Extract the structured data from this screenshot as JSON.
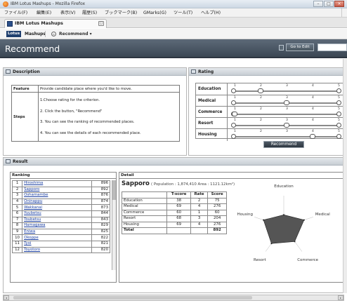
{
  "window": {
    "title": "IBM Lotus Mashups - Mozilla Firefox",
    "min": "–",
    "max": "□",
    "close": "×"
  },
  "menubar": {
    "items": [
      "ファイル(F)",
      "編集(E)",
      "表示(V)",
      "履歴(S)",
      "ブックマーク(B)",
      "GMarks(G)",
      "ツール(T)",
      "ヘルプ(H)"
    ]
  },
  "tab": {
    "label": "IBM Lotus Mashups"
  },
  "lotusbar": {
    "logo": "Lotus",
    "app": "Mashups",
    "page": "Recommend ▾"
  },
  "header": {
    "title": "Recommend",
    "go_edit": "Go to Edit"
  },
  "description": {
    "title": "Description",
    "feature_label": "Feature",
    "feature_text": "Provide candidate place where you'd like to move.",
    "steps_label": "Steps",
    "steps": [
      "1.Choose rating for the criterion.",
      "2. Click the button, \"Recommend\"",
      "3. You can see the ranking of recommended places.",
      "4. You can see the details of each recommended place."
    ]
  },
  "rating": {
    "title": "Rating",
    "criteria": [
      "Education",
      "Medical",
      "Commerce",
      "Resort",
      "Housing"
    ],
    "values": [
      2,
      3,
      1,
      3,
      4
    ],
    "scale": [
      "1",
      "2",
      "3",
      "4",
      "5"
    ],
    "button": "Recommend"
  },
  "result": {
    "title": "Result",
    "ranking_header": "Ranking",
    "ranking": [
      {
        "rank": "1",
        "name": "Hiroshima",
        "score": "896"
      },
      {
        "rank": "2",
        "name": "Sapporo",
        "score": "892"
      },
      {
        "rank": "3",
        "name": "Oshamambe",
        "score": "876"
      },
      {
        "rank": "4",
        "name": "Oninappu",
        "score": "874"
      },
      {
        "rank": "5",
        "name": "Wakkanai",
        "score": "873"
      },
      {
        "rank": "6",
        "name": "Yuubetsu",
        "score": "844"
      },
      {
        "rank": "7",
        "name": "Toubetsu",
        "score": "843"
      },
      {
        "rank": "8",
        "name": "Hamagawa",
        "score": "829"
      },
      {
        "rank": "9",
        "name": "Eniwa",
        "score": "825"
      },
      {
        "rank": "10",
        "name": "Okoppe",
        "score": "822"
      },
      {
        "rank": "11",
        "name": "Tyoi",
        "score": "821"
      },
      {
        "rank": "12",
        "name": "Toyotoro",
        "score": "820"
      }
    ],
    "detail_header": "Detail",
    "city": "Sapporo",
    "city_info": "( Population : 1,874,410   Area : 1121.12km²)",
    "columns": [
      "",
      "T-score",
      "Rate",
      "Score"
    ],
    "rows": [
      {
        "c": "Education",
        "t": "38",
        "r": "2",
        "s": "75"
      },
      {
        "c": "Medical",
        "t": "69",
        "r": "4",
        "s": "276"
      },
      {
        "c": "Commerce",
        "t": "60",
        "r": "1",
        "s": "60"
      },
      {
        "c": "Resort",
        "t": "68",
        "r": "3",
        "s": "204"
      },
      {
        "c": "Housing",
        "t": "69",
        "r": "4",
        "s": "276"
      }
    ],
    "total_label": "Total",
    "total": "892",
    "radar_labels": [
      "Education",
      "Medical",
      "Commerce",
      "Resort",
      "Housing"
    ],
    "radar_values": [
      38,
      69,
      60,
      68,
      69
    ]
  },
  "colors": {
    "accent": "#3b4754",
    "link": "#1a3ea0",
    "radar_fill": "#555555"
  }
}
